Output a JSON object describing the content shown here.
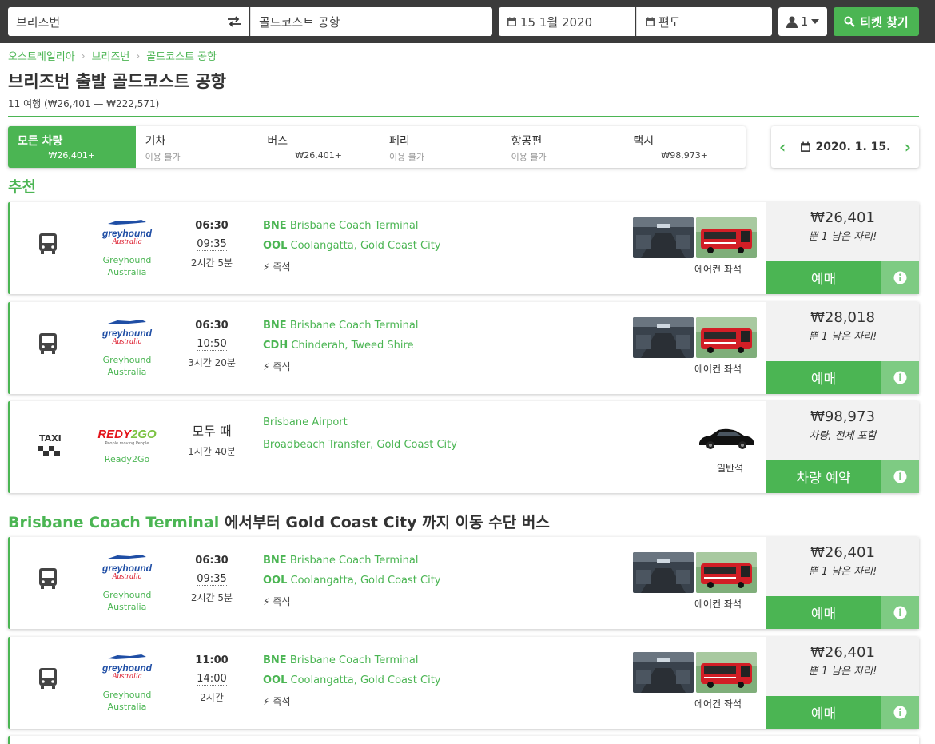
{
  "search": {
    "from": "브리즈번",
    "to": "골드코스트 공항",
    "date": "15 1월 2020",
    "return": "편도",
    "passengers": "1",
    "button": "티켓 찾기"
  },
  "breadcrumb": [
    "오스트레일리아",
    "브리즈번",
    "골드코스트 공항"
  ],
  "page": {
    "title": "브리즈번 출발 골드코스트 공항",
    "subtitle": "11 여행 (₩26,401 — ₩222,571)"
  },
  "tabs": [
    {
      "name": "모든 차량",
      "sub": "₩26,401+"
    },
    {
      "name": "기차",
      "sub": "이용 불가"
    },
    {
      "name": "버스",
      "sub": "₩26,401+"
    },
    {
      "name": "페리",
      "sub": "이용 불가"
    },
    {
      "name": "항공편",
      "sub": "이용 불가"
    },
    {
      "name": "택시",
      "sub": "₩98,973+"
    }
  ],
  "date_nav": {
    "date": "2020. 1. 15."
  },
  "sections": {
    "recommended": "추천",
    "route_prefix": "Brisbane Coach Terminal",
    "route_rest": " 에서부터 Gold Coast City 까지 이동 수단 버스"
  },
  "results": [
    {
      "operator": "Greyhound Australia",
      "dep": "06:30",
      "arr": "09:35",
      "dur": "2시간 5분",
      "from_code": "BNE",
      "from": "Brisbane Coach Terminal",
      "to_code": "OOL",
      "to": "Coolangatta, Gold Coast City",
      "instant": "즉석",
      "seat": "에어컨 좌석",
      "price": "₩26,401",
      "note": "뿐 1 남은 자리!",
      "book": "예매"
    },
    {
      "operator": "Greyhound Australia",
      "dep": "06:30",
      "arr": "10:50",
      "dur": "3시간 20분",
      "from_code": "BNE",
      "from": "Brisbane Coach Terminal",
      "to_code": "CDH",
      "to": "Chinderah, Tweed Shire",
      "instant": "즉석",
      "seat": "에어컨 좌석",
      "price": "₩28,018",
      "note": "뿐 1 남은 자리!",
      "book": "예매"
    },
    {
      "operator": "Ready2Go",
      "vehicle": "TAXI",
      "anytime": "모두 때",
      "dur": "1시간 40분",
      "from": "Brisbane Airport",
      "to": "Broadbeach Transfer, Gold Coast City",
      "seat": "일반석",
      "price": "₩98,973",
      "note": "차량, 전체 포함",
      "book": "차량 예약"
    },
    {
      "operator": "Greyhound Australia",
      "dep": "06:30",
      "arr": "09:35",
      "dur": "2시간 5분",
      "from_code": "BNE",
      "from": "Brisbane Coach Terminal",
      "to_code": "OOL",
      "to": "Coolangatta, Gold Coast City",
      "instant": "즉석",
      "seat": "에어컨 좌석",
      "price": "₩26,401",
      "note": "뿐 1 남은 자리!",
      "book": "예매"
    },
    {
      "operator": "Greyhound Australia",
      "dep": "11:00",
      "arr": "14:00",
      "dur": "2시간",
      "from_code": "BNE",
      "from": "Brisbane Coach Terminal",
      "to_code": "OOL",
      "to": "Coolangatta, Gold Coast City",
      "instant": "즉석",
      "seat": "에어컨 좌석",
      "price": "₩26,401",
      "note": "뿐 1 남은 자리!",
      "book": "예매"
    }
  ],
  "logo_text": {
    "greyhound": "greyhound",
    "greyhound_sub": "Australia",
    "redy_a": "REDY",
    "redy_b": "2GO",
    "redy_sub": "People moving People"
  },
  "colors": {
    "accent": "#4bb553",
    "accent_light": "#7ecb83",
    "topbar": "#3b3b3b"
  }
}
